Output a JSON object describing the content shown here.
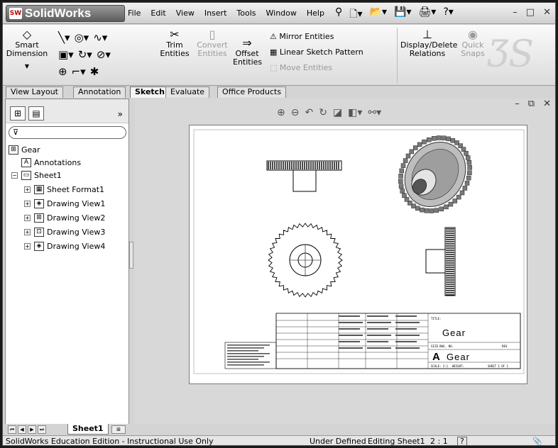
{
  "app": {
    "name": "SolidWorks",
    "logo_text": "SW"
  },
  "menu": [
    "File",
    "Edit",
    "View",
    "Insert",
    "Tools",
    "Window",
    "Help"
  ],
  "ribbon": {
    "smart_dimension": "Smart Dimension",
    "trim": "Trim Entities",
    "convert": "Convert Entities",
    "offset": "Offset Entities",
    "mirror": "Mirror Entities",
    "linear_pattern": "Linear Sketch Pattern",
    "move": "Move Entities",
    "display_delete": "Display/Delete Relations",
    "quick_snaps": "Quick Snaps"
  },
  "command_tabs": [
    "View Layout",
    "Annotation",
    "Sketch",
    "Evaluate",
    "Office Products"
  ],
  "active_tab": "Sketch",
  "feature_tree": {
    "root": "Gear",
    "annotations": "Annotations",
    "sheet": "Sheet1",
    "children": [
      "Sheet Format1",
      "Drawing View1",
      "Drawing View2",
      "Drawing View3",
      "Drawing View4"
    ]
  },
  "sheet_tab": "Sheet1",
  "title_block": {
    "title": "Gear",
    "size": "A",
    "dwg_no": "Gear",
    "size_label": "SIZE",
    "dwg_no_label": "DWG. NO.",
    "rev_label": "REV",
    "scale": "SCALE: 2:1",
    "weight": "WEIGHT:",
    "sheet": "SHEET 1 OF 1",
    "title_label": "TITLE:"
  },
  "status": {
    "edition": "SolidWorks Education Edition - Instructional Use Only",
    "state": "Under Defined",
    "editing": "Editing Sheet1",
    "scale": "2 : 1",
    "help": "?"
  }
}
